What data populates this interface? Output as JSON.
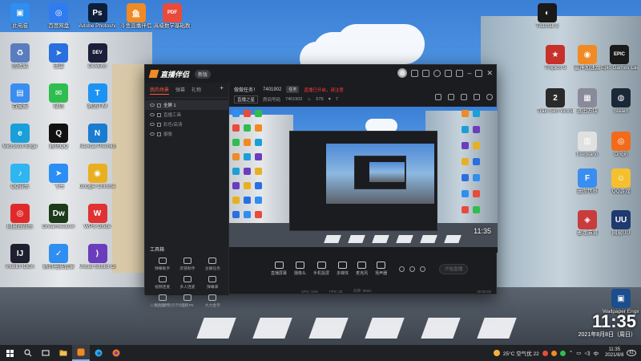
{
  "desktop": {
    "clock_time": "11:35",
    "clock_date": "2021年8月8日（周日）",
    "icons_left": [
      {
        "label": "此电脑",
        "icon": "computer-icon",
        "color": "#2f8ef0",
        "glyph": "▣"
      },
      {
        "label": "百度网盘",
        "icon": "baidu-netdisk-icon",
        "color": "#2f7bf0",
        "glyph": "◎"
      },
      {
        "label": "Adobe Photoshop",
        "icon": "photoshop-icon",
        "color": "#0d1e3a",
        "glyph": "Ps"
      },
      {
        "label": "斗鱼直播伴侣",
        "icon": "douyu-icon",
        "color": "#f08a24",
        "glyph": "鱼"
      },
      {
        "label": "高级数学基础教材.pdf",
        "icon": "pdf-icon",
        "color": "#e84b3c",
        "glyph": "PDF"
      },
      {
        "label": "回收站",
        "icon": "recycle-bin-icon",
        "color": "#5a7dbe",
        "glyph": "♻"
      },
      {
        "label": "迅雷",
        "icon": "thunder-icon",
        "color": "#2a6fe0",
        "glyph": "➤"
      },
      {
        "label": "DevEco",
        "icon": "deveco-icon",
        "color": "#1b1f3a",
        "glyph": "DEV"
      },
      {
        "label": "百宝箱",
        "icon": "toolbox-icon",
        "color": "#3b8df0",
        "glyph": "▤"
      },
      {
        "label": "微信",
        "icon": "wechat-icon",
        "color": "#2fbd4e",
        "glyph": "✉"
      },
      {
        "label": "腾讯TIM",
        "icon": "tim-icon",
        "color": "#1b93f5",
        "glyph": "T"
      },
      {
        "label": "Microsoft Edge",
        "icon": "edge-icon",
        "color": "#1b9fd8",
        "glyph": "e"
      },
      {
        "label": "腾讯QQ",
        "icon": "qq-icon",
        "color": "#111111",
        "glyph": "Q"
      },
      {
        "label": "Navicat Premium",
        "icon": "navicat-icon",
        "color": "#1a7cd0",
        "glyph": "N"
      },
      {
        "label": "QQ音乐",
        "icon": "qq-music-icon",
        "color": "#2fb5f0",
        "glyph": "♪"
      },
      {
        "label": "飞书",
        "icon": "feishu-icon",
        "color": "#2a8ef5",
        "glyph": "➤"
      },
      {
        "label": "Google Chrome",
        "icon": "chrome-icon",
        "color": "#e8b020",
        "glyph": "◉"
      },
      {
        "label": "网易云音乐",
        "icon": "netease-music-icon",
        "color": "#e02a2a",
        "glyph": "◎"
      },
      {
        "label": "Dreamweaver",
        "icon": "dreamweaver-icon",
        "color": "#1d3b1a",
        "glyph": "Dw"
      },
      {
        "label": "WPS Office",
        "icon": "wps-icon",
        "color": "#e03232",
        "glyph": "W"
      },
      {
        "label": "IntelliJ IDEA",
        "icon": "idea-icon",
        "color": "#1f1f2f",
        "glyph": "IJ"
      },
      {
        "label": "腾讯电脑管家",
        "icon": "pc-manager-icon",
        "color": "#2f8ef0",
        "glyph": "✓"
      },
      {
        "label": "Visual Studio Code",
        "icon": "vscode-icon",
        "color": "#6a3dbd",
        "glyph": "⟩"
      }
    ],
    "icons_right": [
      {
        "label": "Titanfall 2",
        "icon": "titanfall-icon",
        "color": "#1a1a1a",
        "glyph": "◐"
      },
      {
        "label": "Tropico 5",
        "icon": "tropico-icon",
        "color": "#c8302a",
        "glyph": "★"
      },
      {
        "label": "雷神加速器",
        "icon": "leishen-icon",
        "color": "#f08a24",
        "glyph": "◉"
      },
      {
        "label": "Epic Games Launcher",
        "icon": "epic-icon",
        "color": "#1a1a1a",
        "glyph": "EPIC"
      },
      {
        "label": "Train Sim World 2",
        "icon": "trainsim-icon",
        "color": "#2a2a2a",
        "glyph": "2"
      },
      {
        "label": "逃出方块",
        "icon": "tetris-icon",
        "color": "#8a8a9a",
        "glyph": "▦"
      },
      {
        "label": "Steam",
        "icon": "steam-icon",
        "color": "#1b2838",
        "glyph": "◍"
      },
      {
        "label": "freepiano",
        "icon": "piano-icon",
        "color": "#e0e0e0",
        "glyph": "▥"
      },
      {
        "label": "Origin",
        "icon": "origin-icon",
        "color": "#f26b1a",
        "glyph": "◎"
      },
      {
        "label": "迷你世界",
        "icon": "mini-world-icon",
        "color": "#3a8ef0",
        "glyph": "F"
      },
      {
        "label": "QQ游戏",
        "icon": "qq-game-icon",
        "color": "#f5c030",
        "glyph": "☺"
      },
      {
        "label": "雀魂麻将",
        "icon": "mahjong-icon",
        "color": "#c83c3c",
        "glyph": "◈"
      },
      {
        "label": "网易UU",
        "icon": "uu-icon",
        "color": "#1e3a6e",
        "glyph": "UU"
      },
      {
        "label": "Wallpaper Engine",
        "icon": "wallpaper-engine-icon",
        "color": "#1b4e8e",
        "glyph": "▣"
      }
    ]
  },
  "app": {
    "title": "直播伴侣",
    "version": "新版",
    "tabs": [
      {
        "label": "我的场景",
        "active": true
      },
      {
        "label": "弹幕",
        "active": false
      },
      {
        "label": "礼物",
        "active": false
      }
    ],
    "scenes": [
      {
        "label": "全屏 1",
        "selected": true
      },
      {
        "label": "直播工具",
        "selected": false
      },
      {
        "label": "彩色/高清",
        "selected": false
      },
      {
        "label": "摄像",
        "selected": false
      }
    ],
    "tools_title": "工具箱",
    "tools": [
      {
        "label": "弹幕助手",
        "icon": "danmaku-icon"
      },
      {
        "label": "房管助手",
        "icon": "room-admin-icon"
      },
      {
        "label": "主播任务",
        "icon": "task-icon"
      },
      {
        "label": "视频连麦",
        "icon": "video-link-icon"
      },
      {
        "label": "多人连麦",
        "icon": "multi-link-icon"
      },
      {
        "label": "弹幕库",
        "icon": "danmaku-library-icon"
      },
      {
        "label": "粉丝助手",
        "icon": "fans-icon"
      },
      {
        "label": "全民PK",
        "icon": "pk-icon"
      },
      {
        "label": "大力金币",
        "icon": "coin-icon"
      }
    ],
    "notice": "斗鱼直播伴侣使用教程",
    "room": {
      "task_label": "做做任务！",
      "room_id": "7401902",
      "task_badge": "任务",
      "alert": "直播已开启，请注意",
      "category": "直播之星",
      "room_label": "房间号码",
      "room_value": "7401902",
      "hot": "579",
      "fans": "7"
    },
    "controls": [
      {
        "label": "直播屏幕",
        "icon": "screen-icon"
      },
      {
        "label": "摄像头",
        "icon": "camera-icon"
      },
      {
        "label": "手机投屏",
        "icon": "phone-cast-icon"
      },
      {
        "label": "多媒体",
        "icon": "media-icon"
      },
      {
        "label": "麦克风",
        "icon": "mic-icon"
      },
      {
        "label": "扬声器",
        "icon": "speaker-icon"
      }
    ],
    "start_button": "开始直播",
    "status": {
      "cpu": "CPU: 14%",
      "fps": "FPS: 30",
      "bitrate": "码率: 0kb/s",
      "time": "00:00:00"
    },
    "preview_clock": "11:35"
  },
  "taskbar": {
    "weather": "25°C 空气优 22",
    "ime": "中",
    "time": "11:35",
    "date": "2021/8/8",
    "notifications": "61"
  },
  "colors": {
    "accent": "#ff5a3c",
    "app_bg": "#1b1c1f",
    "taskbar_bg": "#202124"
  }
}
